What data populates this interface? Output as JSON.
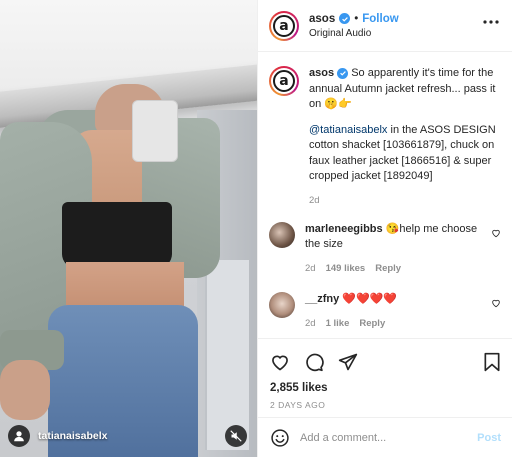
{
  "media": {
    "username": "tatianaisabelx"
  },
  "header": {
    "account": "asos",
    "separator": "•",
    "follow_label": "Follow",
    "subtitle": "Original Audio"
  },
  "caption": {
    "account": "asos",
    "text": "So apparently it's time for the annual Autumn jacket refresh... pass it on 🤫👉",
    "mention": "@tatianaisabelx",
    "tags_text": " in the ASOS DESIGN cotton shacket [103661879], chuck on faux leather jacket [1866516] & super cropped jacket [1892049]",
    "time": "2d"
  },
  "comments": [
    {
      "account": "marleneegibbs",
      "text": "😘help me choose the size",
      "time": "2d",
      "likes": "149 likes",
      "reply": "Reply"
    },
    {
      "account": "__zfny",
      "text": "❤️❤️❤️❤️",
      "time": "2d",
      "likes": "1 like",
      "reply": "Reply"
    }
  ],
  "actions": {
    "likes": "2,855 likes",
    "date": "2 DAYS AGO"
  },
  "add_comment": {
    "placeholder": "Add a comment...",
    "post_label": "Post"
  },
  "colors": {
    "link_blue": "#3897f0",
    "mention": "#00376b",
    "muted_text": "#8e8e8e",
    "post_disabled": "#b2dffc"
  },
  "icons": [
    "avatar-person-icon",
    "mute-icon",
    "verified-badge-icon",
    "more-icon",
    "heart-icon",
    "comment-icon",
    "share-icon",
    "bookmark-icon",
    "emoji-icon"
  ]
}
